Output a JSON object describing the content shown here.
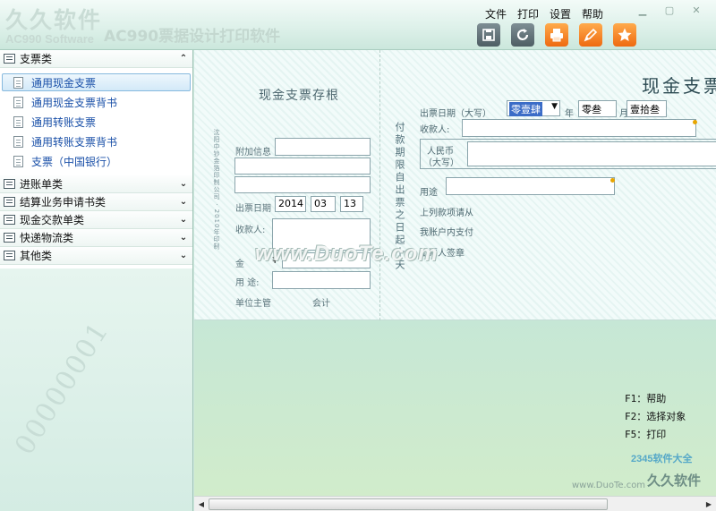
{
  "window": {
    "brand": "久久软件",
    "brand_sub": "AC990 Software",
    "title": "AC990票据设计打印软件"
  },
  "menu": [
    "文件",
    "打印",
    "设置",
    "帮助"
  ],
  "window_controls": [
    "minimize-icon",
    "maximize-icon",
    "close-icon"
  ],
  "toolbar": [
    {
      "name": "save-icon",
      "glyph": "▣"
    },
    {
      "name": "refresh-icon",
      "glyph": "G"
    },
    {
      "name": "print-icon",
      "glyph": "⎙"
    },
    {
      "name": "design-icon",
      "glyph": "✎"
    },
    {
      "name": "favorite-icon",
      "glyph": "★"
    }
  ],
  "sidebar": {
    "groups": [
      {
        "label": "支票类",
        "expanded": true,
        "items": [
          {
            "label": "通用现金支票",
            "selected": true
          },
          {
            "label": "通用现金支票背书",
            "selected": false
          },
          {
            "label": "通用转账支票",
            "selected": false
          },
          {
            "label": "通用转账支票背书",
            "selected": false
          },
          {
            "label": "支票（中国银行）",
            "selected": false
          }
        ]
      },
      {
        "label": "进账单类",
        "expanded": false
      },
      {
        "label": "结算业务申请书类",
        "expanded": false
      },
      {
        "label": "现金交款单类",
        "expanded": false
      },
      {
        "label": "快递物流类",
        "expanded": false
      },
      {
        "label": "其他类",
        "expanded": false
      }
    ]
  },
  "stub": {
    "title": "现金支票存根",
    "vertical_text": "沈阳中钞金箔印制公司 · 2010年印制",
    "extra_info_label": "附加信息",
    "date_label": "出票日期",
    "year": "2014",
    "month": "03",
    "day": "13",
    "payee_label": "收款人:",
    "amount_label": "金",
    "amount_symbol": "¥",
    "purpose_label": "用 途:",
    "supervisor_label": "单位主管",
    "accountant_label": "会计"
  },
  "cheque": {
    "title": "现金支票",
    "vertical_text": "付款期限自出票之日起十天",
    "date_label": "出票日期（大写）",
    "year_value": "零壹肆",
    "year_suffix": "年",
    "month_value": "零叁",
    "month_suffix": "月",
    "day_value": "壹拾叁",
    "payee_label": "收款人:",
    "rmb_label_1": "人民币",
    "rmb_label_2": "（大写）",
    "purpose_label": "用途",
    "line1": "上列款项请从",
    "line2": "我账户内支付",
    "signer_label": "出票人签章"
  },
  "watermarks": {
    "duote": "www.DuoTe.com",
    "bottom_brand": "久久软件",
    "site_logo": "2345软件大全",
    "site_url": "www.DuoTe.com",
    "sidebar_number": "00000001"
  },
  "shortcuts": [
    "F1：帮助",
    "F2：选择对象",
    "F5：打印"
  ],
  "scrollbar": {
    "thumb_fraction": 0.81
  }
}
